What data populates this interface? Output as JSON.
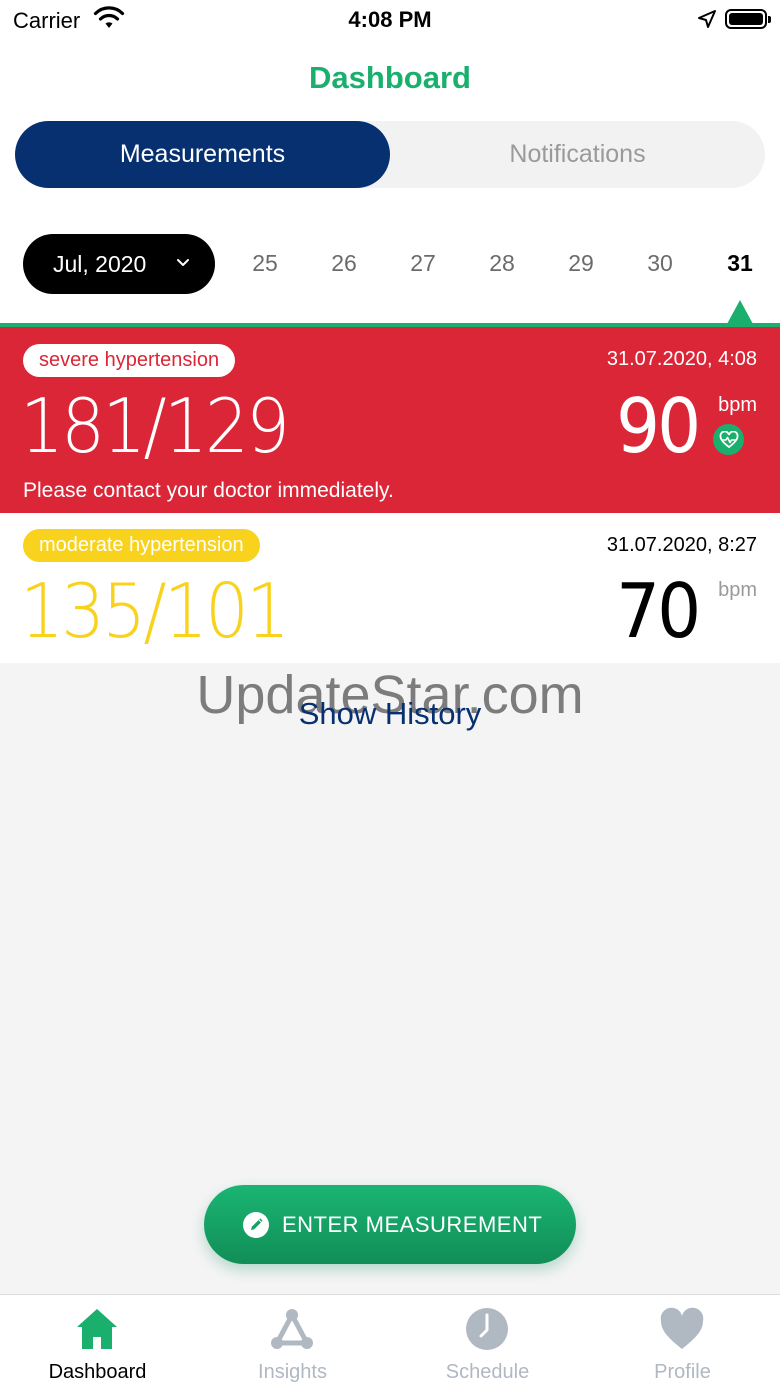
{
  "status_bar": {
    "carrier": "Carrier",
    "time": "4:08 PM"
  },
  "header": {
    "title": "Dashboard"
  },
  "segments": {
    "active": "Measurements",
    "inactive": "Notifications"
  },
  "date_picker": {
    "month": "Jul, 2020",
    "days": [
      "25",
      "26",
      "27",
      "28",
      "29",
      "30",
      "31"
    ],
    "selected_day": "31"
  },
  "measurements": [
    {
      "status": "severe hypertension",
      "timestamp": "31.07.2020, 4:08",
      "bp": "181/129",
      "pulse": "90",
      "unit": "bpm",
      "note": "Please contact your doctor immediately.",
      "color": "#da2637"
    },
    {
      "status": "moderate hypertension",
      "timestamp": "31.07.2020, 8:27",
      "bp": "135/101",
      "pulse": "70",
      "unit": "bpm",
      "color": "#f8d21c"
    }
  ],
  "watermark": "UpdateStar.com",
  "show_history": "Show History",
  "enter_button": {
    "label": "ENTER MEASUREMENT"
  },
  "tabs": [
    {
      "label": "Dashboard",
      "icon": "home-icon"
    },
    {
      "label": "Insights",
      "icon": "insights-icon"
    },
    {
      "label": "Schedule",
      "icon": "clock-icon"
    },
    {
      "label": "Profile",
      "icon": "heart-icon"
    }
  ],
  "colors": {
    "brand_green": "#1aaf6c",
    "navy": "#073070",
    "red": "#da2637",
    "yellow": "#f8d21c"
  }
}
